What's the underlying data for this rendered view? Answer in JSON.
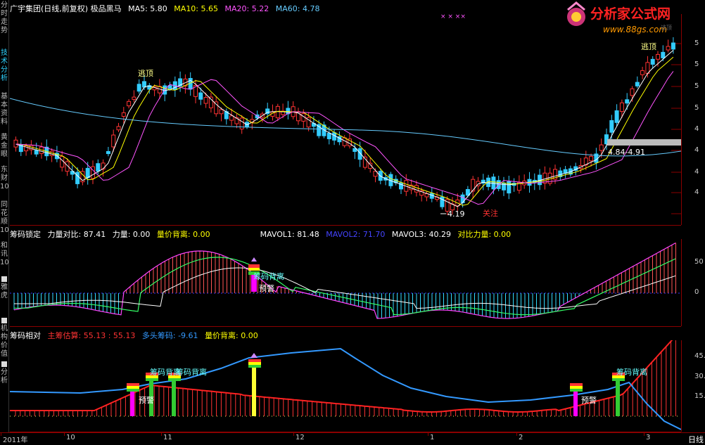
{
  "sidebar": {
    "items": [
      {
        "label": "分时走势",
        "active": false
      },
      {
        "label": "技术分析",
        "active": true
      },
      {
        "label": "基本资料",
        "active": false
      },
      {
        "label": "黄金眼",
        "active": false
      },
      {
        "label": "东财10",
        "active": false
      },
      {
        "label": "同花顺10",
        "active": false
      },
      {
        "label": "和讯10",
        "active": false
      },
      {
        "label": "雅虎",
        "active": false
      },
      {
        "label": "机构价值",
        "active": false
      },
      {
        "label": "分析",
        "active": false
      }
    ]
  },
  "logo": {
    "title": "分析家公式网",
    "url": "www.88gs.com"
  },
  "main_chart": {
    "title": "广宇集团(日线,前复权) 极品黑马",
    "ma": [
      {
        "label": "MA5: 5.80",
        "color": "#ffffff"
      },
      {
        "label": "MA10: 5.65",
        "color": "#ffff00"
      },
      {
        "label": "MA20: 5.22",
        "color": "#ff55ff"
      },
      {
        "label": "MA60: 4.78",
        "color": "#66ccff"
      }
    ],
    "annotations": {
      "escape_top_1": "逃顶",
      "escape_top_2": "逃顶",
      "low_price": "4.19",
      "attention": "关注",
      "range": "4.84-4.91",
      "hidden_label": "逃顶"
    },
    "ticks": [
      "5",
      "5",
      "5",
      "5",
      "4",
      "4",
      "4",
      "4"
    ]
  },
  "chip_lock": {
    "header": [
      {
        "label": "筹码锁定",
        "color": "#ffffff"
      },
      {
        "label": "力量对比: 87.41",
        "color": "#ffffff"
      },
      {
        "label": "力量: 0.00",
        "color": "#ffffff"
      },
      {
        "label": "量价背离: 0.00",
        "color": "#ffff00"
      }
    ],
    "mavol": [
      {
        "label": "MAVOL1: 81.48",
        "color": "#ffffff"
      },
      {
        "label": "MAVOL2: 71.70",
        "color": "#4444ff"
      },
      {
        "label": "MAVOL3: 40.29",
        "color": "#ffffff"
      },
      {
        "label": "对比力量: 0.00",
        "color": "#ffff00"
      }
    ],
    "labels": {
      "divergence": "筹码背离",
      "warning": "预警"
    },
    "ticks": [
      "50",
      "0"
    ]
  },
  "chip_relative": {
    "header": [
      {
        "label": "筹码相对",
        "color": "#ffffff"
      },
      {
        "label": "主筹估算: 55.13 : 55.13",
        "color": "#ff3333"
      },
      {
        "label": "多头筹码: -9.61",
        "color": "#3399ff"
      },
      {
        "label": "量价背离: 0.00",
        "color": "#ffff00"
      }
    ],
    "labels": {
      "div1": "筹码背离",
      "div2": "筹码背离",
      "div3": "筹码背离",
      "warn1": "预警",
      "warn2": "预警"
    },
    "ticks": [
      "45.",
      "30.",
      "15."
    ]
  },
  "date_axis": {
    "labels": [
      "2011年",
      "10",
      "11",
      "12",
      "1",
      "2",
      "3"
    ],
    "period": "日线"
  }
}
